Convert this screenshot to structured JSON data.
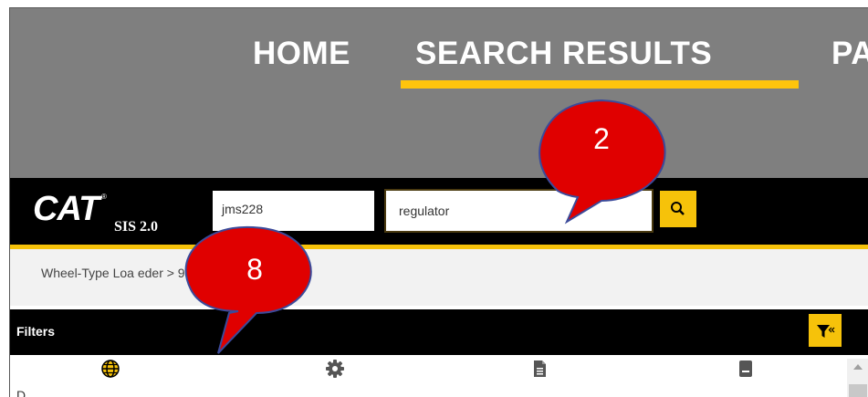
{
  "nav": {
    "items": [
      {
        "label": "HOME"
      },
      {
        "label": "SEARCH RESULTS"
      },
      {
        "label": "PA"
      }
    ]
  },
  "brand": {
    "logo": "CAT",
    "trademark": "®",
    "product": "SIS 2.0"
  },
  "search": {
    "model_value": "jms228",
    "query_value": "regulator"
  },
  "breadcrumb": {
    "text": "Wheel-Type Loa         eder > 980H > JMS"
  },
  "filters": {
    "label": "Filters"
  },
  "tabs": {
    "icons": [
      "globe-icon",
      "gear-icon",
      "document-icon",
      "book-icon"
    ]
  },
  "content": {
    "partial_text": "D"
  },
  "callouts": [
    {
      "number": "2"
    },
    {
      "number": "8"
    }
  ],
  "colors": {
    "accent": "#f6c20a",
    "nav_bg": "#7f7f7f",
    "callout": "#e00000"
  }
}
